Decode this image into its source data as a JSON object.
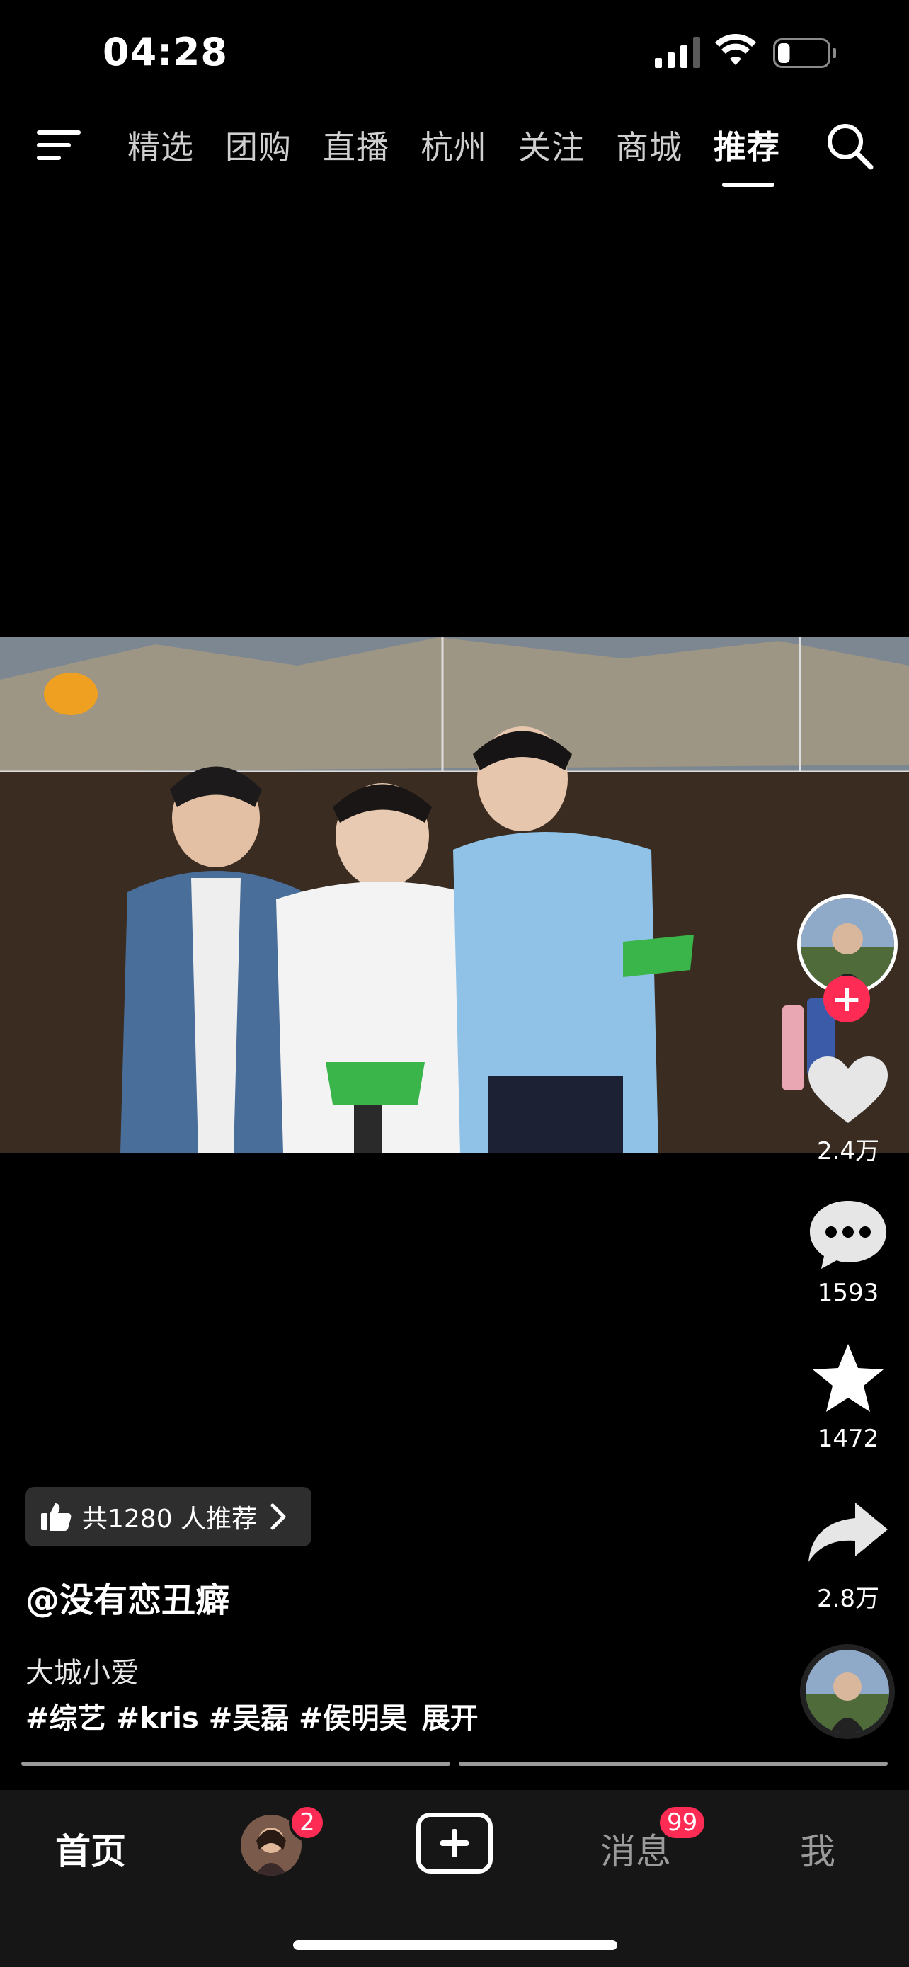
{
  "status_bar": {
    "time": "04:28",
    "battery_level": 0.25
  },
  "top_nav": {
    "tabs": [
      "精选",
      "团购",
      "直播",
      "杭州",
      "关注",
      "商城",
      "推荐"
    ],
    "active_tab": "推荐"
  },
  "video": {
    "description": "three young men sitting on a stage in front of a large screen"
  },
  "right_rail": {
    "like_count": "2.4万",
    "comment_count": "1593",
    "favorite_count": "1472",
    "share_count": "2.8万"
  },
  "post": {
    "recommend_chip": "共1280 人推荐",
    "author": "@没有恋丑癖",
    "caption": "大城小爱",
    "tags": "#综艺 #kris #吴磊 #侯明昊",
    "expand": "展开"
  },
  "bottom_nav": {
    "home": "首页",
    "friends_badge": "2",
    "messages": "消息",
    "messages_badge": "99",
    "me": "我"
  },
  "colors": {
    "accent": "#fe2c55",
    "background": "#000000",
    "bar": "#161616"
  }
}
